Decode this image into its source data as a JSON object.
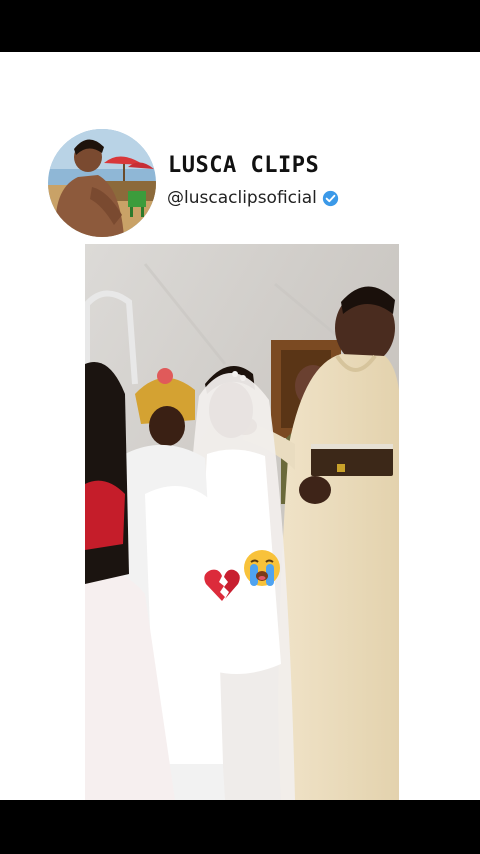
{
  "post": {
    "channel_name": "LUSCA CLIPS",
    "handle": "@luscaclipsoficial",
    "verified": true
  },
  "icons": {
    "avatar": "avatar-photo",
    "verified": "verified-check-icon",
    "reaction_1": "broken-heart-emoji",
    "reaction_2": "loudly-crying-face-emoji"
  },
  "colors": {
    "verified_blue": "#3b99e8",
    "broken_heart_red": "#dc2b3b",
    "crying_face_yellow": "#f8c23a"
  }
}
